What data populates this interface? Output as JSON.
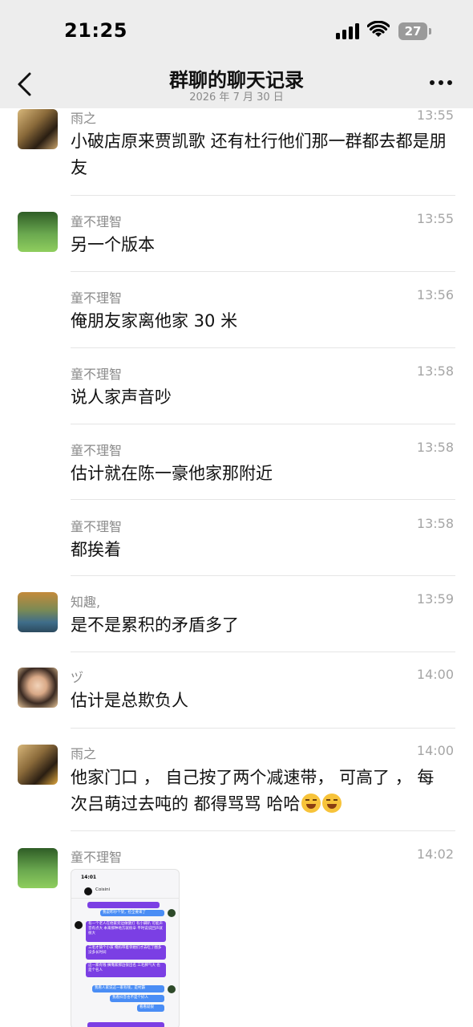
{
  "status_bar": {
    "time": "21:25",
    "battery": "27"
  },
  "header": {
    "title": "群聊的聊天记录",
    "date": "2026 年 7 月 30 日"
  },
  "messages": [
    {
      "name": "雨之",
      "time": "13:55",
      "text": "小破店原来贾凯歌 还有杜行他们那一群都去都是朋友"
    },
    {
      "name": "童不理智",
      "time": "13:55",
      "text": "另一个版本"
    },
    {
      "name": "童不理智",
      "time": "13:56",
      "text": "俺朋友家离他家 30 米"
    },
    {
      "name": "童不理智",
      "time": "13:58",
      "text": "说人家声音吵"
    },
    {
      "name": "童不理智",
      "time": "13:58",
      "text": "估计就在陈一豪他家那附近"
    },
    {
      "name": "童不理智",
      "time": "13:58",
      "text": "都挨着"
    },
    {
      "name": "知趣,",
      "time": "13:59",
      "text": "是不是累积的矛盾多了"
    },
    {
      "name": "ヅ",
      "time": "14:00",
      "text": "估计是总欺负人"
    },
    {
      "name": "雨之",
      "time": "14:00",
      "text": "他家门口 ， 自己按了两个减速带， 可高了 ， 每次吕萌过去吨的 都得骂骂 哈哈"
    },
    {
      "name": "童不理智",
      "time": "14:02",
      "text": ""
    }
  ],
  "thumbnail": {
    "time": "14:01",
    "contact": "Coisini",
    "lines": [
      "我说昨吵个架，捡全要来了",
      "有一个老人在他家旁边做健灯 有小脚趴 可能声音有点大 本来那种地方就很辛 平时说说回声就很大",
      "三毛才骑个小孩 俺妈带着邻她们才去吃了圈多没多长时间",
      "这一家有钱 搁俺家那边很出名 三毛脾气大 也是个名人",
      "我看人家说这一家有钱，是村霸",
      "我看抖音也不是个好人",
      "看看就很"
    ]
  }
}
